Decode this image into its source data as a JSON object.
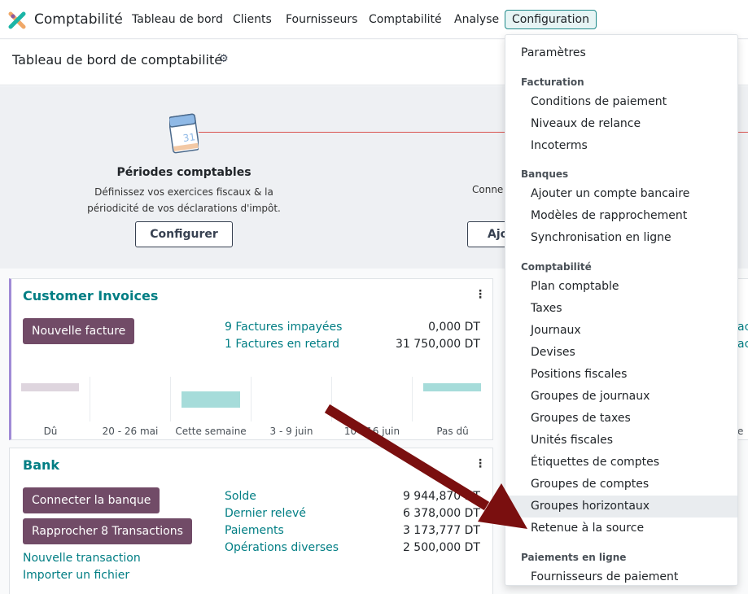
{
  "nav": {
    "app_title": "Comptabilité",
    "menus": [
      "Tableau de bord",
      "Clients",
      "Fournisseurs",
      "Comptabilité",
      "Analyse",
      "Configuration"
    ]
  },
  "control_panel": {
    "title": "Tableau de bord de comptabilité"
  },
  "onboarding": {
    "calendar_day": "31",
    "step1_title": "Périodes comptables",
    "step1_desc_line1": "Définissez vos exercices fiscaux & la",
    "step1_desc_line2": "périodicité de vos déclarations d'impôt.",
    "step1_button": "Configurer",
    "step2_text": "Conne",
    "step2_button": "Ajo"
  },
  "customer_invoices": {
    "title": "Customer Invoices",
    "new_button": "Nouvelle facture",
    "stats": [
      {
        "label": "9 Factures impayées",
        "amount": "0,000 DT"
      },
      {
        "label": "1 Factures en retard",
        "amount": "31 750,000 DT"
      }
    ],
    "chart_labels": [
      "Dû",
      "20 - 26 mai",
      "Cette semaine",
      "3 - 9 juin",
      "10 - 16 juin",
      "Pas dû"
    ]
  },
  "bank": {
    "title": "Bank",
    "buttons": [
      "Connecter la banque",
      "Rapprocher 8 Transactions"
    ],
    "links": [
      "Nouvelle transaction",
      "Importer un fichier"
    ],
    "stats": [
      {
        "label": "Solde",
        "amount": "9 944,870 DT"
      },
      {
        "label": "Dernier relevé",
        "amount": "6 378,000 DT"
      },
      {
        "label": "Paiements",
        "amount": "3 173,777 DT"
      },
      {
        "label": "Opérations diverses",
        "amount": "2 500,000 DT"
      }
    ]
  },
  "right_peek": [
    "ac",
    "ac",
    "e"
  ],
  "dropdown": {
    "top_item": "Paramètres",
    "sections": [
      {
        "header": "Facturation",
        "items": [
          "Conditions de paiement",
          "Niveaux de relance",
          "Incoterms"
        ]
      },
      {
        "header": "Banques",
        "items": [
          "Ajouter un compte bancaire",
          "Modèles de rapprochement",
          "Synchronisation en ligne"
        ]
      },
      {
        "header": "Comptabilité",
        "items": [
          "Plan comptable",
          "Taxes",
          "Journaux",
          "Devises",
          "Positions fiscales",
          "Groupes de journaux",
          "Groupes de taxes",
          "Unités fiscales",
          "Étiquettes de comptes",
          "Groupes de comptes",
          "Groupes horizontaux",
          "Retenue à la source"
        ]
      },
      {
        "header": "Paiements en ligne",
        "items": [
          "Fournisseurs de paiement"
        ]
      }
    ]
  },
  "colors": {
    "accent": "#017e84",
    "primary": "#714b67",
    "annotation_arrow": "#7a0f0f"
  }
}
